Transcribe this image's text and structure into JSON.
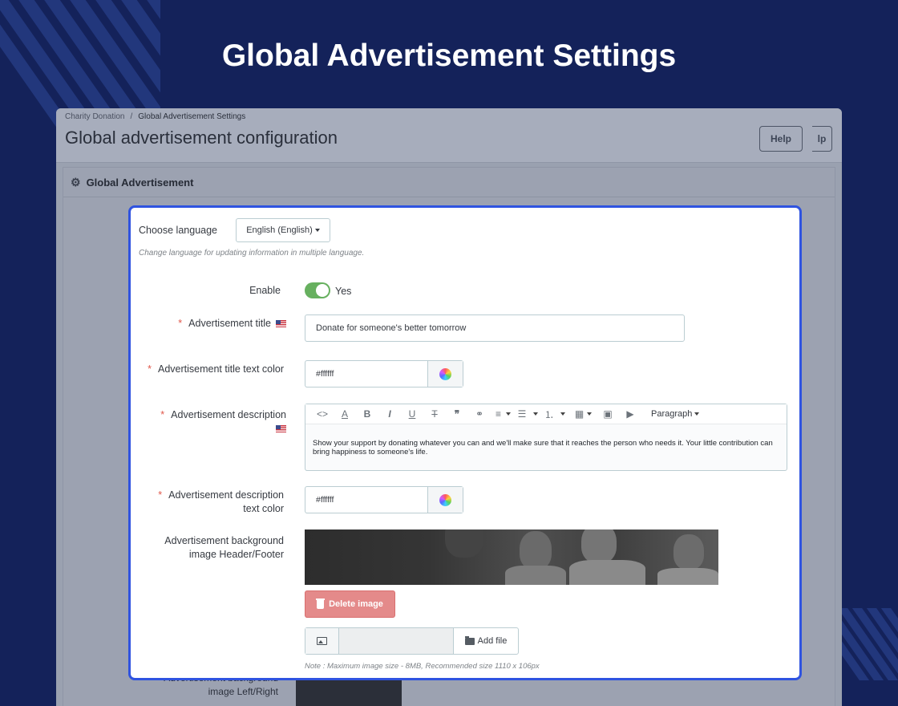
{
  "hero": {
    "title": "Global Advertisement Settings"
  },
  "backoffice": {
    "breadcrumb": {
      "parent": "Charity Donation",
      "separator": "/",
      "current": "Global Advertisement Settings"
    },
    "heading": "Global advertisement configuration",
    "help_label": "Help",
    "help_label_partial": "lp",
    "panel_title": "Global Advertisement",
    "ghost_label": "Advertisement background image Left/Right"
  },
  "form": {
    "language": {
      "label": "Choose language",
      "selected": "English (English)",
      "help": "Change language for updating information in multiple language."
    },
    "enable": {
      "label": "Enable",
      "state_text": "Yes",
      "on": true
    },
    "title": {
      "label": "Advertisement title",
      "value": "Donate for someone's better tomorrow"
    },
    "title_color": {
      "label": "Advertisement title text color",
      "value": "#ffffff"
    },
    "description": {
      "label": "Advertisement description",
      "format": "Paragraph",
      "text": "Show your support by donating whatever you can and we'll make sure that it reaches the person who needs it. Your little contribution can bring happiness to someone's life."
    },
    "description_color": {
      "label": "Advertisement description text color",
      "value": "#ffffff"
    },
    "bg_header_footer": {
      "label": "Advertisement background image Header/Footer",
      "delete_label": "Delete image",
      "add_file_label": "Add file",
      "note": "Note : Maximum image size - 8MB, Recommended size 1110 x 106px"
    }
  },
  "colors": {
    "background": "#14225a",
    "accent": "#2f53e0",
    "toggle": "#67b05f",
    "danger": "#e48a8a",
    "required": "#e0574a"
  },
  "icons": [
    "gears-icon",
    "flag-us-icon",
    "color-wheel-icon",
    "trash-icon",
    "image-icon",
    "folder-open-icon"
  ]
}
